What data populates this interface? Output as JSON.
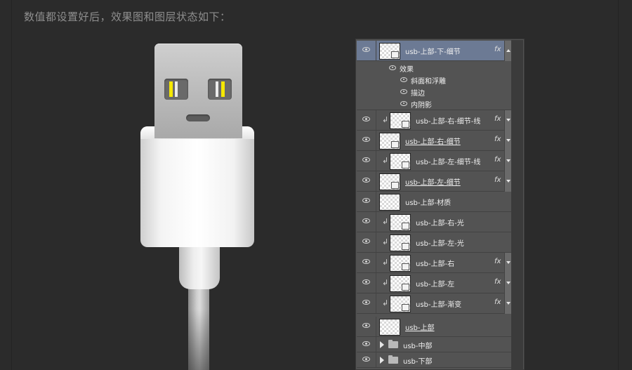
{
  "caption": "数值都设置好后，效果图和图层状态如下：",
  "layers": [
    {
      "name": "usb-上部-下-细节",
      "selected": true,
      "clipped": false,
      "fx": true,
      "underline": false
    },
    {
      "name": "usb-上部-右-细节-线",
      "clipped": true,
      "fx": true,
      "underline": false
    },
    {
      "name": "usb-上部-右-细节",
      "clipped": false,
      "fx": true,
      "underline": true
    },
    {
      "name": "usb-上部-左-细节-线",
      "clipped": true,
      "fx": true,
      "underline": false
    },
    {
      "name": "usb-上部-左-细节",
      "clipped": false,
      "fx": true,
      "underline": true
    },
    {
      "name": "usb-上部-材质",
      "clipped": false,
      "fx": false,
      "underline": false
    },
    {
      "name": "usb-上部-右-光",
      "clipped": true,
      "fx": false,
      "underline": false
    },
    {
      "name": "usb-上部-左-光",
      "clipped": true,
      "fx": false,
      "underline": false
    },
    {
      "name": "usb-上部-右",
      "clipped": true,
      "fx": true,
      "underline": false
    },
    {
      "name": "usb-上部-左",
      "clipped": true,
      "fx": true,
      "underline": false
    },
    {
      "name": "usb-上部-渐变",
      "clipped": true,
      "fx": true,
      "underline": false
    },
    {
      "name": "usb-上部",
      "clipped": false,
      "fx": false,
      "underline": true
    }
  ],
  "effects": {
    "title": "效果",
    "items": [
      "斜面和浮雕",
      "描边",
      "内阴影"
    ]
  },
  "groups": [
    "usb-中部",
    "usb-下部"
  ],
  "fx_label": "fx",
  "clip_symbol": "↲"
}
